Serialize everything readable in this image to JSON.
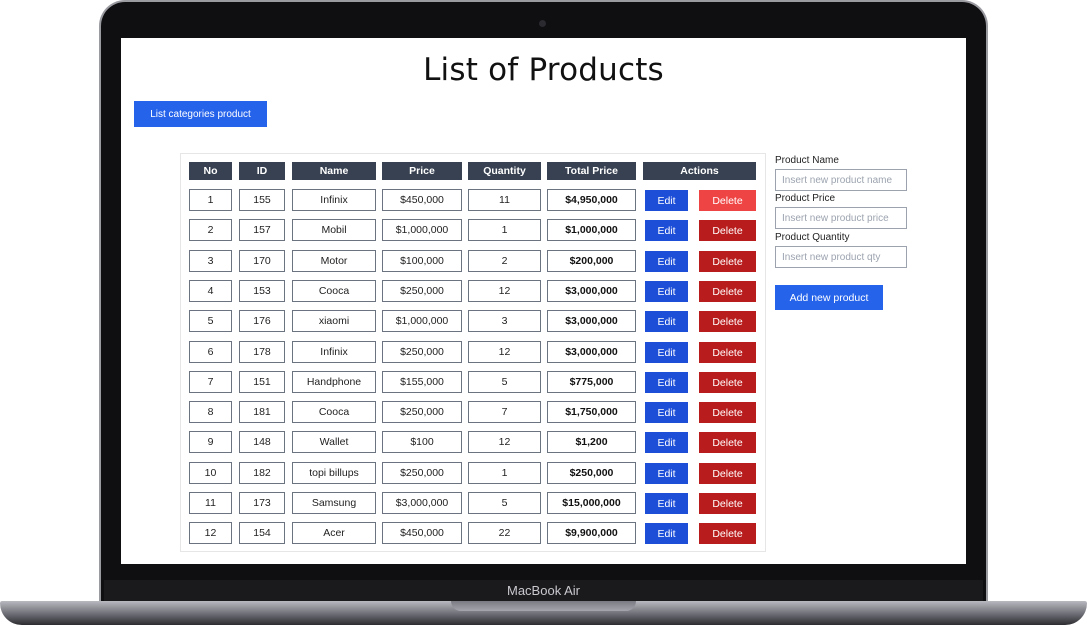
{
  "device": {
    "brand_label": "MacBook Air"
  },
  "page": {
    "title": "List of Products",
    "categories_button_label": "List categories product"
  },
  "table": {
    "columns": [
      "No",
      "ID",
      "Name",
      "Price",
      "Quantity",
      "Total Price",
      "Actions"
    ],
    "edit_label": "Edit",
    "delete_label": "Delete",
    "rows": [
      {
        "no": "1",
        "id": "155",
        "name": "Infinix",
        "price": "$450,000",
        "qty": "11",
        "total": "$4,950,000"
      },
      {
        "no": "2",
        "id": "157",
        "name": "Mobil",
        "price": "$1,000,000",
        "qty": "1",
        "total": "$1,000,000"
      },
      {
        "no": "3",
        "id": "170",
        "name": "Motor",
        "price": "$100,000",
        "qty": "2",
        "total": "$200,000"
      },
      {
        "no": "4",
        "id": "153",
        "name": "Cooca",
        "price": "$250,000",
        "qty": "12",
        "total": "$3,000,000"
      },
      {
        "no": "5",
        "id": "176",
        "name": "xiaomi",
        "price": "$1,000,000",
        "qty": "3",
        "total": "$3,000,000"
      },
      {
        "no": "6",
        "id": "178",
        "name": "Infinix",
        "price": "$250,000",
        "qty": "12",
        "total": "$3,000,000"
      },
      {
        "no": "7",
        "id": "151",
        "name": "Handphone",
        "price": "$155,000",
        "qty": "5",
        "total": "$775,000"
      },
      {
        "no": "8",
        "id": "181",
        "name": "Cooca",
        "price": "$250,000",
        "qty": "7",
        "total": "$1,750,000"
      },
      {
        "no": "9",
        "id": "148",
        "name": "Wallet",
        "price": "$100",
        "qty": "12",
        "total": "$1,200"
      },
      {
        "no": "10",
        "id": "182",
        "name": "topi billups",
        "price": "$250,000",
        "qty": "1",
        "total": "$250,000"
      },
      {
        "no": "11",
        "id": "173",
        "name": "Samsung",
        "price": "$3,000,000",
        "qty": "5",
        "total": "$15,000,000"
      },
      {
        "no": "12",
        "id": "154",
        "name": "Acer",
        "price": "$450,000",
        "qty": "22",
        "total": "$9,900,000"
      }
    ]
  },
  "form": {
    "name_label": "Product Name",
    "name_placeholder": "Insert new product name",
    "price_label": "Product Price",
    "price_placeholder": "Insert new product price",
    "qty_label": "Product Quantity",
    "qty_placeholder": "Insert new product qty",
    "submit_label": "Add new product"
  },
  "colors": {
    "primary": "#2563eb",
    "edit": "#1d4ed8",
    "delete": "#b91c1c",
    "delete_hover": "#ef4444",
    "header": "#374151"
  }
}
